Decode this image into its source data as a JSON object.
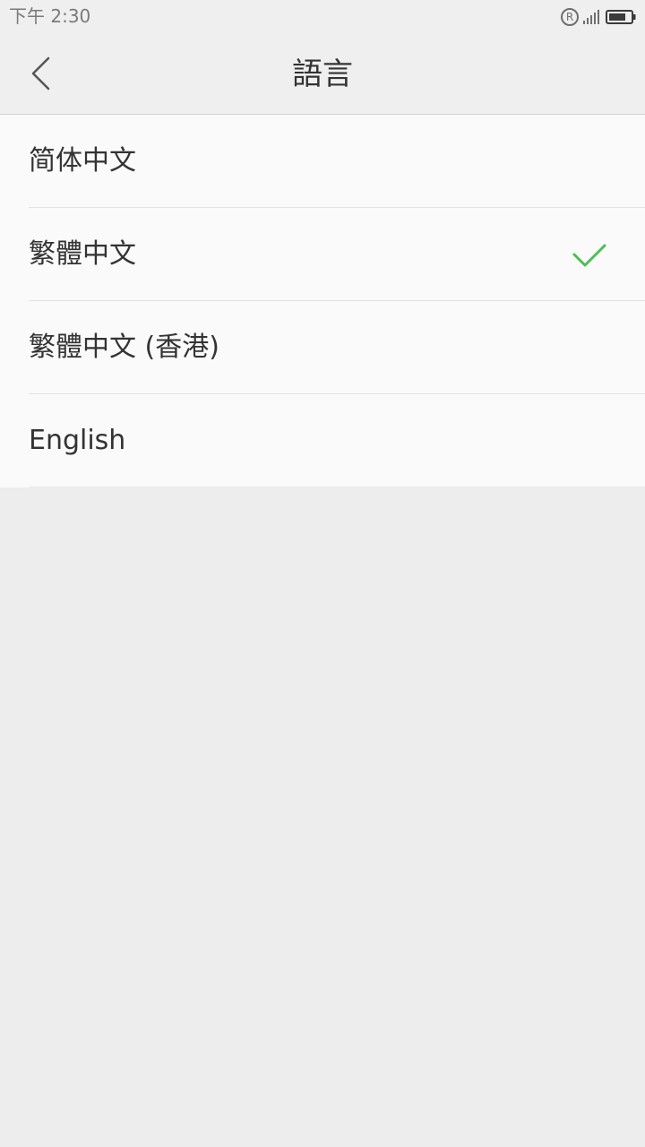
{
  "status_bar": {
    "time": "下午 2:30",
    "roaming": "R",
    "icons": [
      "roaming-icon",
      "signal-icon",
      "battery-icon"
    ]
  },
  "header": {
    "title": "語言",
    "back_icon": "chevron-left-icon"
  },
  "languages": [
    {
      "label": "简体中文",
      "selected": false
    },
    {
      "label": "繁體中文",
      "selected": true
    },
    {
      "label": "繁體中文 (香港)",
      "selected": false
    },
    {
      "label": "English",
      "selected": false
    }
  ],
  "colors": {
    "accent_check": "#4cbf52",
    "text": "#333333",
    "background": "#ededed",
    "list_background": "#fafafa"
  }
}
